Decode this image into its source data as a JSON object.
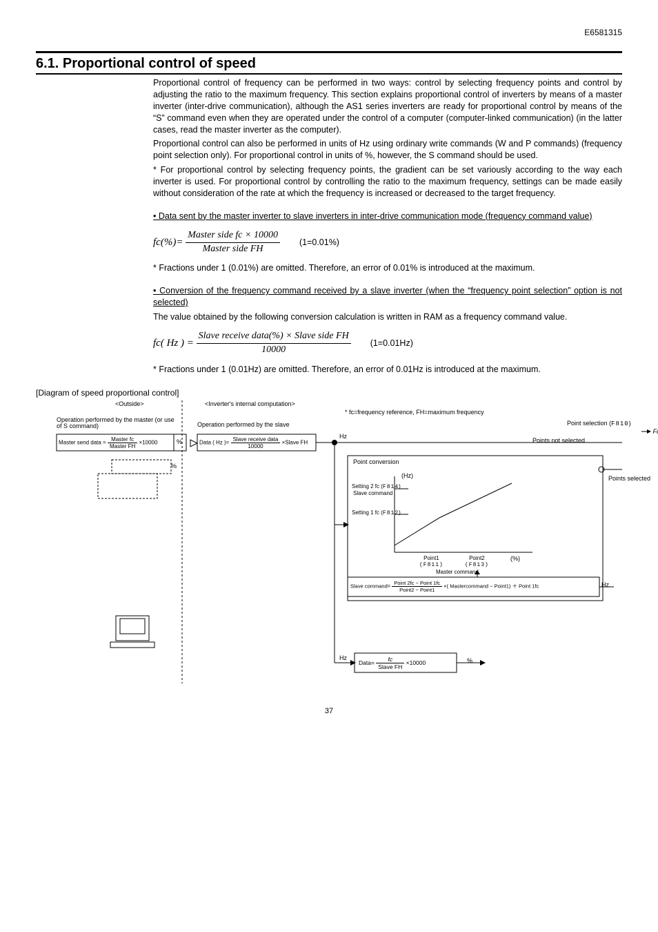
{
  "docid": "E6581315",
  "heading": "6.1.  Proportional control of speed",
  "p1": "Proportional control of frequency can be performed in two ways: control by selecting frequency points and control by adjusting the ratio to the maximum frequency. This section explains proportional control of inverters by means of a master inverter (inter-drive communication), although the AS1 series inverters are ready for proportional control by means of the “S” command even when they are operated under the control of a computer (computer-linked communication) (in the latter cases, read the master inverter as the computer).",
  "p2": "Proportional control can also be performed in units of Hz using ordinary write commands (W and P commands) (frequency point selection only). For proportional control in units of %, however, the S command should be used.",
  "p3": "* For proportional control by selecting frequency points, the gradient can be set variously according to the way each inverter is used. For proportional control by controlling the ratio to the maximum frequency, settings can be made easily without consideration of the rate at which the frequency is increased or decreased to the target frequency.",
  "bullet1": "• Data sent by the master inverter to slave inverters in inter-drive communication mode (frequency command value)",
  "eq1": {
    "lhs": "fc(%)",
    "num": "Master side  fc × 10000",
    "den": "Master side FH",
    "aside": "(1=0.01%)"
  },
  "note1": "* Fractions under 1 (0.01%) are omitted. Therefore, an error of 0.01% is introduced at the maximum.",
  "bullet2": "• Conversion of the frequency command received by a slave inverter (when the “frequency point selection” option is not selected)",
  "p4": "The value obtained by the following conversion calculation is written in RAM as a frequency command value.",
  "eq2": {
    "lhs": "fc( Hz )",
    "num": "Slave receive data(%) × Slave side FH",
    "den": "10000",
    "aside": "(1=0.01Hz)"
  },
  "note2": "* Fractions under 1 (0.01Hz) are omitted. Therefore, an error of 0.01Hz is introduced at the maximum.",
  "diagTitle": "[Diagram of speed proportional control]",
  "d": {
    "outside": "<Outside>",
    "internal": "<Inverter's internal computation>",
    "legend": "*  fc=frequency reference, FH=maximum frequency",
    "opMaster": "Operation performed by the master (or use of S command)",
    "opSlave": "Operation performed by the slave",
    "masterSend_pre": "Master send data =",
    "masterSend_num": "Master fc",
    "masterSend_den": "Master FH",
    "masterSend_post": "×10000",
    "pct": "%",
    "slaveEq_pre": "Data ( Hz  )=",
    "slaveEq_num": "Slave  receive  data",
    "slaveEq_den": "10000",
    "slaveEq_post": "×Slave  FH",
    "hz": "Hz",
    "pointSel": "Point selection (",
    "pointSelCode": "F810",
    "pointSel2": ")",
    "fcHz": "Fc (Hz)",
    "notSel": "Points not selected",
    "selected": "Points selected",
    "pointConv": "Point conversion",
    "axHz": "(Hz)",
    "setting2": "Setting 2 fc (",
    "setting2code": "F814",
    "setting2b": ")",
    "slaveCmd": "Slave command",
    "setting1": "Setting 1 fc (",
    "setting1code": "F812",
    "setting1b": ")",
    "p1lbl": "Point1",
    "p1code": "(F811)",
    "p2lbl": "Point2",
    "p2code": "(F813)",
    "axpct": "(%)",
    "masterCmd": "Master command",
    "eqLinePre": "Slave command=",
    "eqLineNum": "Point 2fc − Point 1fc",
    "eqLineDen": "Point2 − Point1",
    "eqLinePost": "×( Mastercommand − Point1) ＋ Point 1fc",
    "bottomPre": "Data=",
    "bottomNum": "fc",
    "bottomDen": "Slave FH",
    "bottomPost": "×10000"
  },
  "pagenum": "37"
}
